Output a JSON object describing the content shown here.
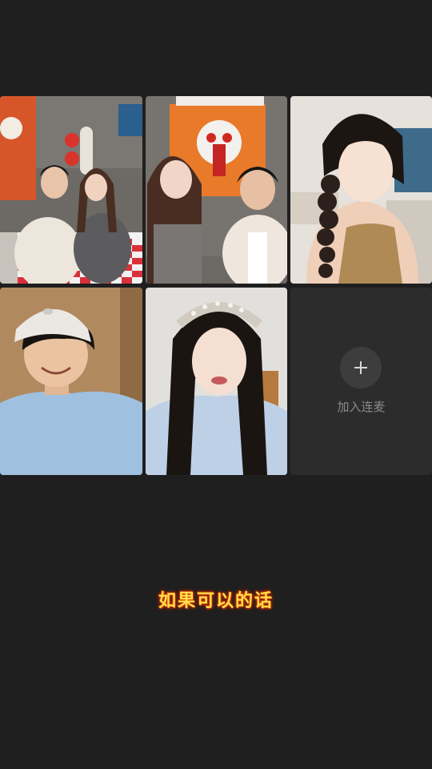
{
  "call_grid": {
    "tiles": [
      {
        "type": "video",
        "icon": "two-guests-restaurant"
      },
      {
        "type": "video",
        "icon": "two-guests-lion-dance"
      },
      {
        "type": "video",
        "icon": "woman-braid"
      },
      {
        "type": "video",
        "icon": "man-white-cap"
      },
      {
        "type": "video",
        "icon": "woman-headband"
      }
    ],
    "join": {
      "icon": "plus-icon",
      "label": "加入连麦"
    }
  },
  "subtitle": {
    "text": "如果可以的话"
  },
  "colors": {
    "background": "#1f1f1f",
    "empty_tile": "#2c2c2c",
    "subtitle_fill": "#ffe04a",
    "subtitle_glow": "#d43a00"
  }
}
